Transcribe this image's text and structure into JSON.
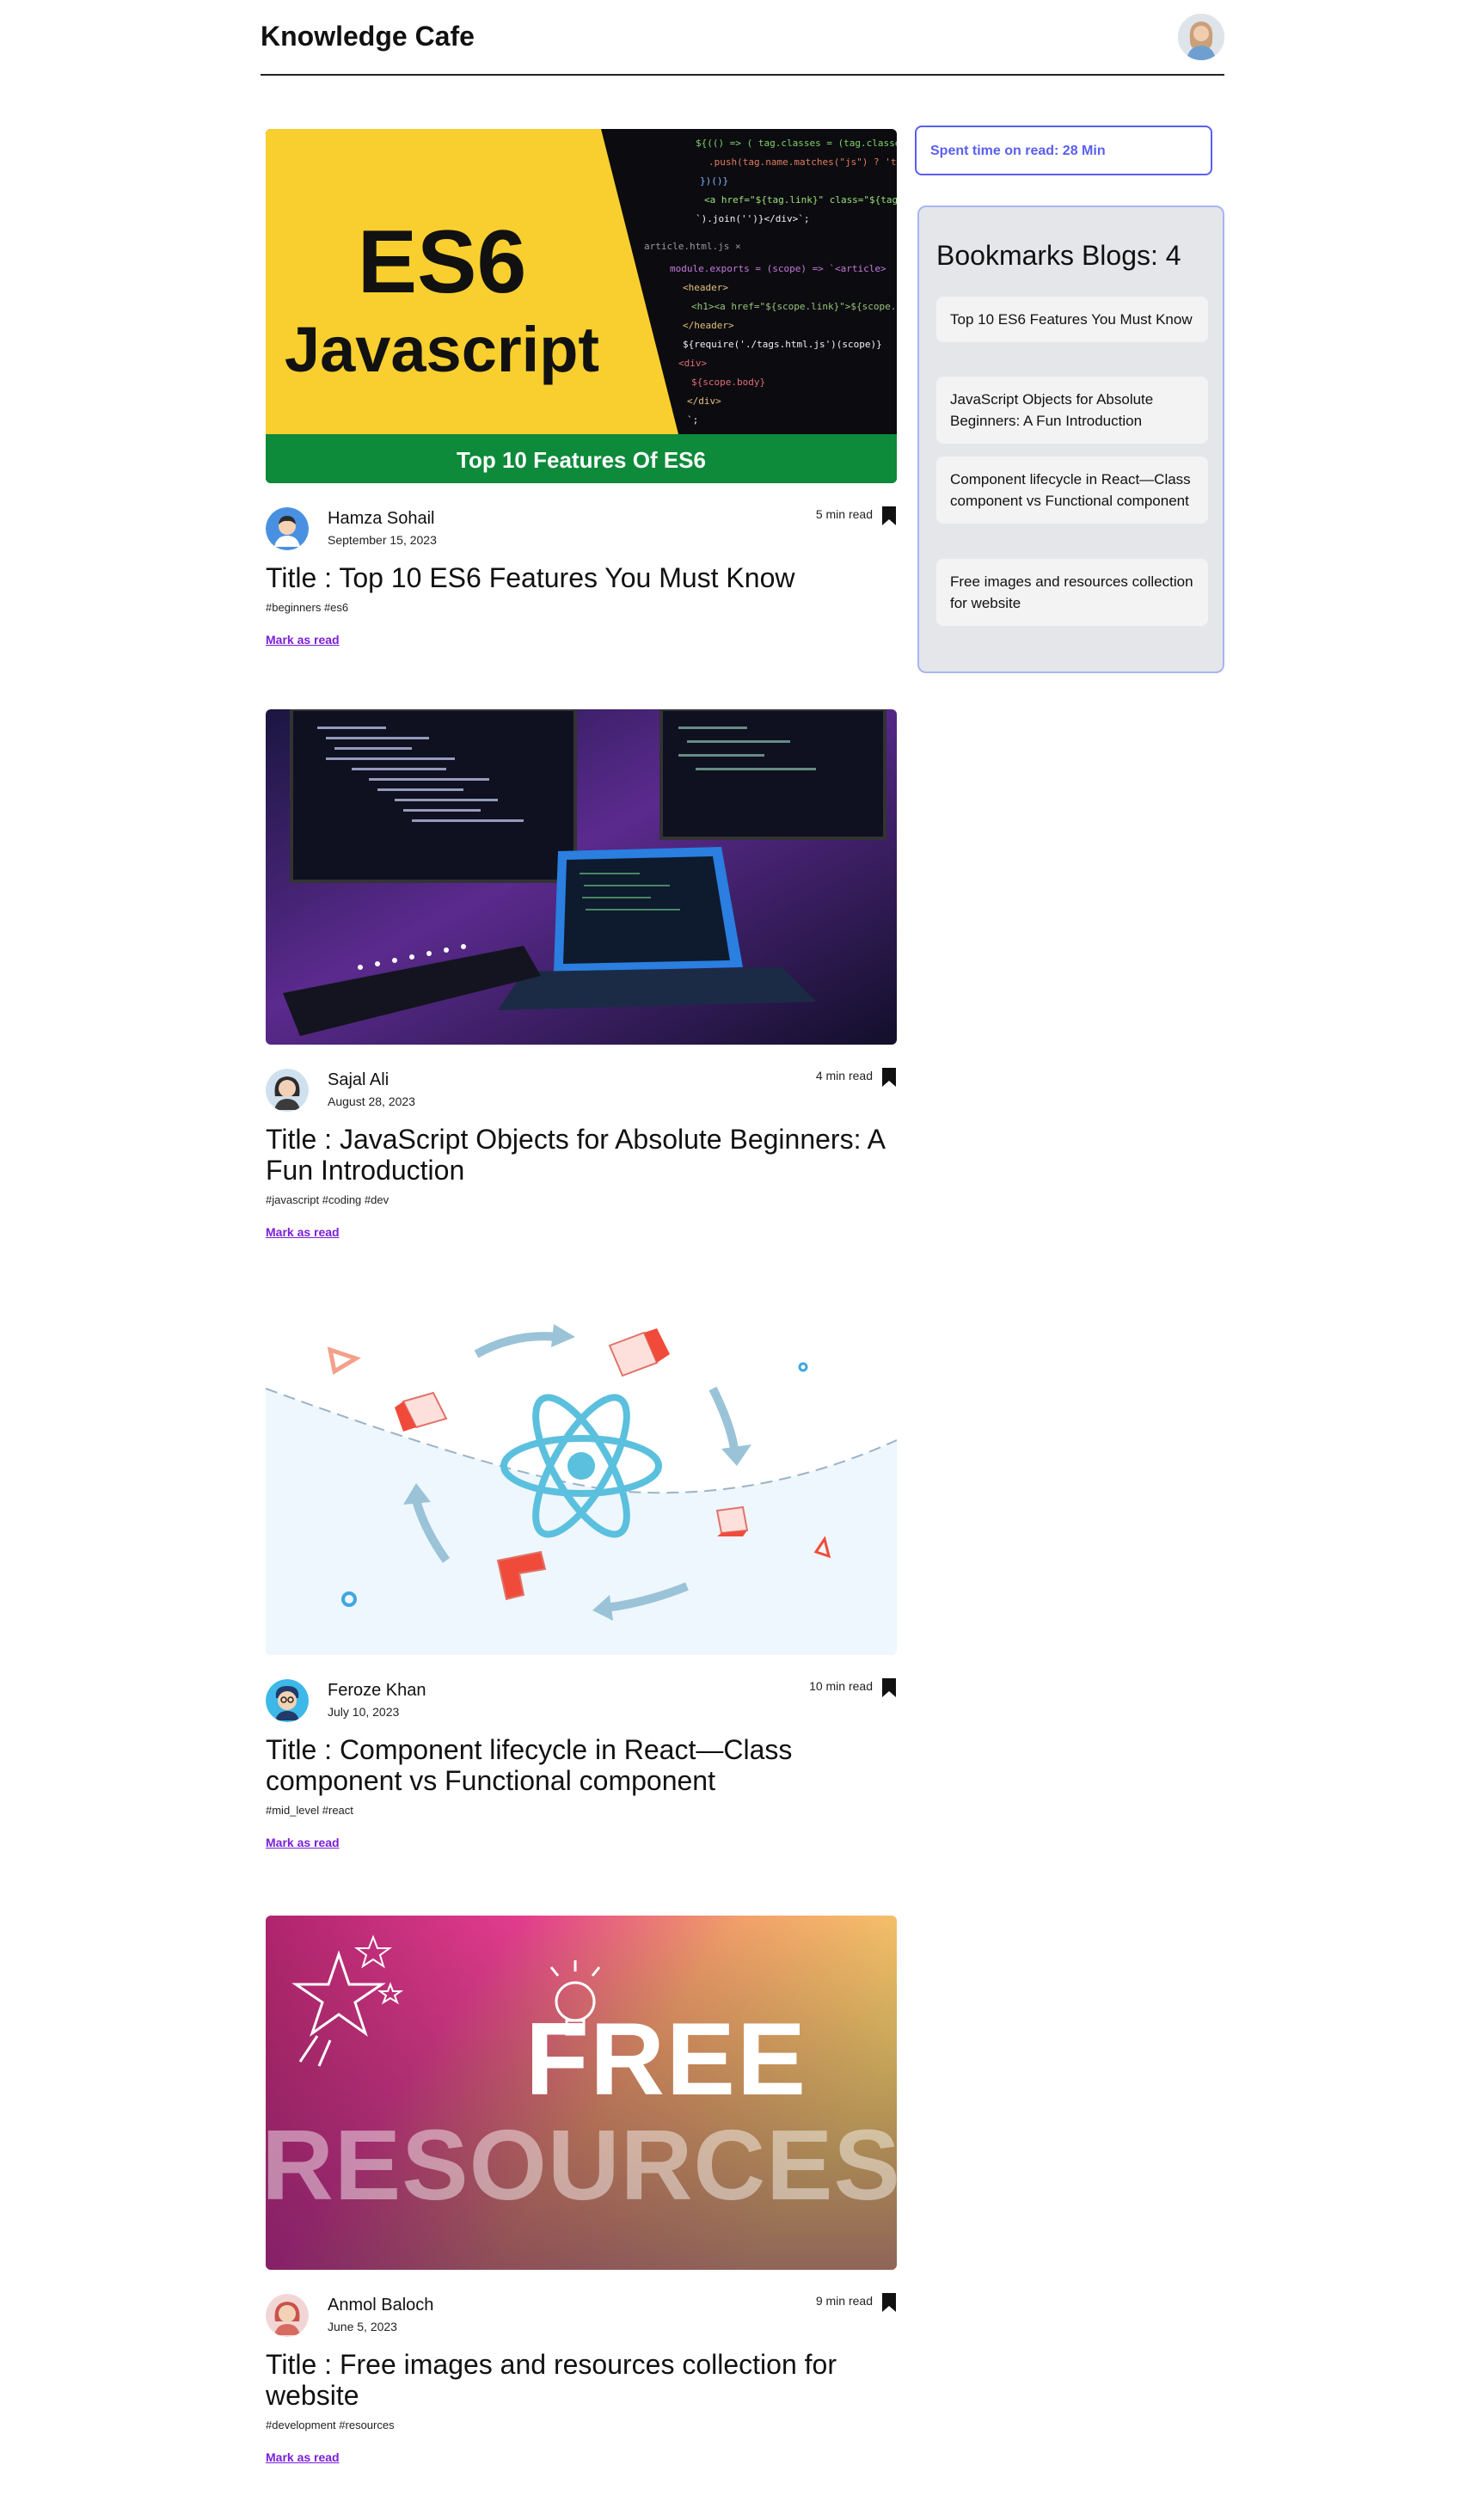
{
  "header": {
    "logo": "Knowledge Cafe",
    "avatar_icon": "user-avatar-icon"
  },
  "sidebar": {
    "spent_time": "Spent time on read: 28 Min",
    "bookmarks_heading": "Bookmarks Blogs: 4",
    "bookmarks": [
      "Top 10 ES6 Features You Must Know",
      "JavaScript Objects for Absolute Beginners: A Fun Introduction",
      "Component lifecycle in React—Class component vs Functional component",
      "Free images and resources collection for website"
    ]
  },
  "blogs": [
    {
      "author": "Hamza Sohail",
      "date": "September 15, 2023",
      "read_time": "5 min read",
      "title": "Title : Top 10 ES6 Features You Must Know",
      "hashtags": "#beginners #es6",
      "mark_read": "Mark as read",
      "cover": {
        "headline1": "ES6",
        "headline2": "Javascript",
        "banner": "Top 10 Features Of ES6"
      }
    },
    {
      "author": "Sajal Ali",
      "date": "August 28, 2023",
      "read_time": "4 min read",
      "title": "Title : JavaScript Objects for Absolute Beginners: A Fun Introduction",
      "hashtags": "#javascript #coding #dev",
      "mark_read": "Mark as read"
    },
    {
      "author": "Feroze Khan",
      "date": "July 10, 2023",
      "read_time": "10 min read",
      "title": "Title : Component lifecycle in React—Class component vs Functional component",
      "hashtags": "#mid_level #react",
      "mark_read": "Mark as read"
    },
    {
      "author": "Anmol Baloch",
      "date": "June 5, 2023",
      "read_time": "9 min read",
      "title": "Title : Free images and resources collection for website",
      "hashtags": "#development #resources",
      "mark_read": "Mark as read",
      "cover": {
        "line1": "FREE",
        "line2": "RESOURCES"
      }
    }
  ],
  "colors": {
    "accent": "#5a5ef0",
    "link": "#7a1fd8",
    "panel": "#e5e6ea"
  }
}
